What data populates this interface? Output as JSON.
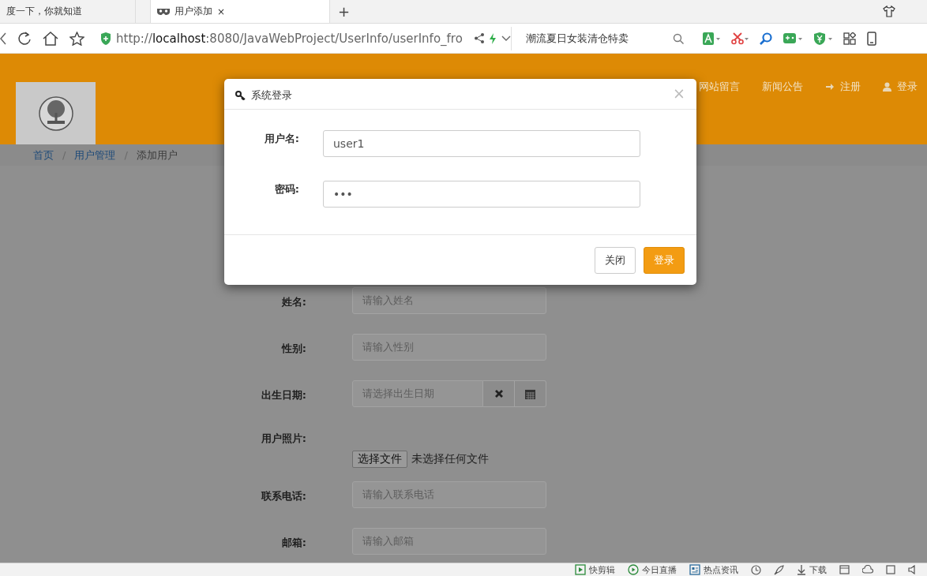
{
  "browser": {
    "tabs": [
      {
        "label": "度一下，你就知道",
        "selected": false
      },
      {
        "label": "用户添加",
        "selected": true,
        "close": "×"
      }
    ],
    "new_tab": "+",
    "url": {
      "scheme": "http://",
      "host": "localhost",
      "rest": ":8080/JavaWebProject/UserInfo/userInfo_fro"
    },
    "search": {
      "placeholder": "潮流夏日女装清仓特卖"
    }
  },
  "site": {
    "nav": [
      {
        "label": "网站留言"
      },
      {
        "label": "新闻公告"
      },
      {
        "label": "注册"
      },
      {
        "label": "登录"
      }
    ],
    "breadcrumb": [
      {
        "label": "首页",
        "link": true
      },
      {
        "separator": "/",
        "label": "用户管理",
        "link": true
      },
      {
        "separator": "/",
        "label": "添加用户",
        "link": false
      }
    ],
    "form": [
      {
        "kind": "text",
        "label": "姓名:",
        "placeholder": "请输入姓名"
      },
      {
        "kind": "text",
        "label": "性别:",
        "placeholder": "请输入性别"
      },
      {
        "kind": "date",
        "label": "出生日期:",
        "placeholder": "请选择出生日期"
      },
      {
        "kind": "file",
        "label": "用户照片:",
        "button": "选择文件",
        "status": "未选择任何文件"
      },
      {
        "kind": "text",
        "label": "联系电话:",
        "placeholder": "请输入联系电话"
      },
      {
        "kind": "text",
        "label": "邮箱:",
        "placeholder": "请输入邮箱"
      }
    ]
  },
  "modal": {
    "title": "系统登录",
    "close": "×",
    "fields": [
      {
        "label": "用户名:",
        "value": "user1"
      },
      {
        "label": "密码:",
        "value": "•••"
      }
    ],
    "buttons": [
      {
        "label": "关闭",
        "kind": "default"
      },
      {
        "label": "登录",
        "kind": "primary"
      }
    ]
  },
  "status_bar": [
    {
      "label": "快剪辑"
    },
    {
      "label": "今日直播"
    },
    {
      "label": "热点资讯"
    },
    {
      "label": "下载"
    }
  ]
}
